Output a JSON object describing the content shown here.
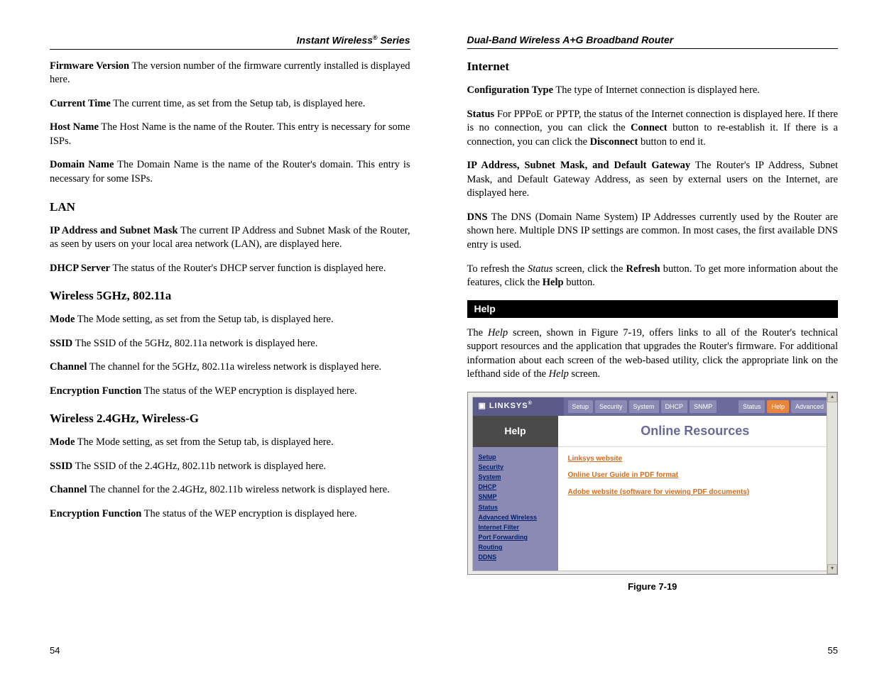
{
  "left": {
    "running_head_pre": "Instant Wireless",
    "running_head_reg": "®",
    "running_head_post": " Series",
    "pagenum": "54",
    "paras": {
      "firmware_label": "Firmware Version",
      "firmware_text": "  The version number of the firmware currently installed is displayed here.",
      "time_label": "Current Time",
      "time_text": "  The current time, as set from the Setup tab, is displayed here.",
      "host_label": "Host Name",
      "host_text": "  The Host Name is the name of the Router. This entry is necessary for some ISPs.",
      "domain_label": "Domain Name",
      "domain_text": "  The Domain Name is the name of the Router's domain. This entry is necessary for some ISPs."
    },
    "lan_heading": "LAN",
    "lan": {
      "ip_label": "IP Address and Subnet Mask",
      "ip_text": "  The current IP Address and Subnet Mask of the Router, as seen by users on your local area network (LAN), are displayed here.",
      "dhcp_label": "DHCP Server",
      "dhcp_text": "  The status of the Router's DHCP server function is displayed here."
    },
    "w5_heading": "Wireless 5GHz, 802.11a",
    "w5": {
      "mode_label": "Mode",
      "mode_text": "  The Mode setting, as set from the Setup tab, is displayed here.",
      "ssid_label": "SSID",
      "ssid_text": "  The SSID of the 5GHz, 802.11a network is displayed here.",
      "chan_label": "Channel",
      "chan_text": "  The channel for the 5GHz, 802.11a wireless network is displayed here.",
      "enc_label": "Encryption Function",
      "enc_text": "  The status of the WEP encryption is displayed here."
    },
    "w24_heading": "Wireless 2.4GHz, Wireless-G",
    "w24": {
      "mode_label": "Mode",
      "mode_text": "  The Mode setting, as set from the Setup tab, is displayed here.",
      "ssid_label": "SSID",
      "ssid_text": "  The SSID of the 2.4GHz, 802.11b network is displayed here.",
      "chan_label": "Channel",
      "chan_text": "  The channel for the 2.4GHz, 802.11b wireless network is displayed here.",
      "enc_label": "Encryption Function",
      "enc_text": "  The status of the WEP encryption is displayed here."
    }
  },
  "right": {
    "running_head": "Dual-Band Wireless A+G Broadband Router",
    "pagenum": "55",
    "internet_heading": "Internet",
    "internet": {
      "cfg_label": "Configuration Type",
      "cfg_text": "  The type of Internet connection is displayed here.",
      "status_label": "Status",
      "status_t1": "  For PPPoE or PPTP, the status of the Internet connection is displayed here. If there is no connection, you can click the ",
      "status_connect": "Connect",
      "status_t2": " button to re-establish it. If there is a connection, you can click the ",
      "status_disconnect": "Disconnect",
      "status_t3": " button to end it.",
      "ip_label": "IP Address, Subnet Mask, and Default Gateway",
      "ip_text": "  The Router's IP Address, Subnet Mask, and Default Gateway Address, as seen by external users on the Internet, are displayed here.",
      "dns_label": "DNS",
      "dns_text": "  The DNS (Domain Name System) IP Addresses currently used by the Router are shown here. Multiple DNS IP settings are common. In most cases, the first available DNS entry is used.",
      "refresh_t1": "To refresh the ",
      "refresh_status": "Status",
      "refresh_t2": " screen, click the ",
      "refresh_btn": "Refresh",
      "refresh_t3": " button. To get more information about the features, click the ",
      "refresh_help": "Help",
      "refresh_t4": " button."
    },
    "help_bar": "Help",
    "help_para_t1": "The ",
    "help_para_help": "Help",
    "help_para_t2": " screen, shown in Figure 7-19, offers links to all of the Router's technical support resources and the application that upgrades the Router's firmware. For additional information about each screen of the web-based utility, click the appropriate link on the lefthand side of the ",
    "help_para_help2": "Help",
    "help_para_t3": " screen.",
    "figure": {
      "brand": "LINKSYS",
      "tabs": [
        "Setup",
        "Security",
        "System",
        "DHCP",
        "SNMP"
      ],
      "tabs_right": [
        "Status",
        "Help",
        "Advanced"
      ],
      "active_tab": "Help",
      "sidebar_title": "Help",
      "main_title": "Online Resources",
      "side_links": [
        "Setup",
        "Security",
        "System",
        "DHCP",
        "SNMP",
        "Status",
        "Advanced Wireless",
        "Internet Filter",
        "Port Forwarding",
        "Routing",
        "DDNS"
      ],
      "main_links": [
        "Linksys website",
        "Online User Guide in PDF format",
        "Adobe website (software for viewing PDF documents)"
      ],
      "caption": "Figure 7-19"
    }
  }
}
